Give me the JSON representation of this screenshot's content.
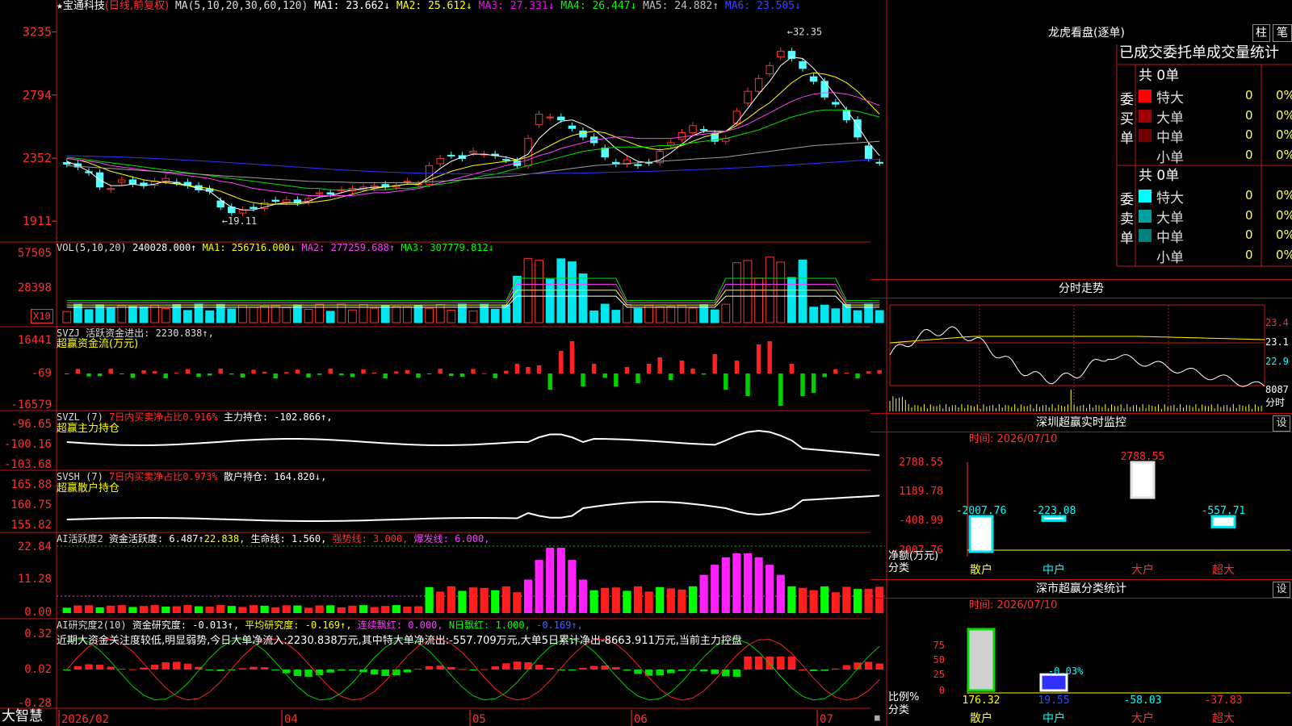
{
  "window": {
    "app_name": "大智慧",
    "date_axis": [
      "2026/02",
      "04",
      "05",
      "06",
      "07"
    ]
  },
  "header": {
    "stock": "宝通科技",
    "mode": "(日线,前复权)",
    "ma_label": "MA(5,10,20,30,60,120)",
    "ma_values": [
      {
        "label": "MA1:",
        "value": "23.662↓",
        "color": "#ffffff"
      },
      {
        "label": "MA2:",
        "value": "25.612↓",
        "color": "#ffff00"
      },
      {
        "label": "MA3:",
        "value": "27.331↓",
        "color": "#ff00ff"
      },
      {
        "label": "MA4:",
        "value": "26.447↓",
        "color": "#00ff00"
      },
      {
        "label": "MA5:",
        "value": "24.882↑",
        "color": "#c0c0c0"
      },
      {
        "label": "MA6:",
        "value": "23.505↓",
        "color": "#4040ff"
      }
    ]
  },
  "panels": {
    "price": {
      "y_ticks": [
        "3235",
        "2794",
        "2352",
        "1911"
      ],
      "high_label": "32.35",
      "low_label": "19.11"
    },
    "vol": {
      "title": "VOL(5,10,20)",
      "value": "240028.000↑",
      "ma1": "MA1: 256716.000↓",
      "ma2": "MA2: 277259.688↑",
      "ma3": "MA3: 307779.812↓",
      "y_ticks": [
        "57505",
        "28398"
      ],
      "unit": "X10"
    },
    "svzj": {
      "title": "SVZJ  活跃资金进出: 2230.838↑,",
      "subtitle": "超赢资金流(万元)",
      "y_ticks": [
        "16441",
        "-69",
        "-16579"
      ]
    },
    "svzl": {
      "title": "SVZL (7)",
      "ratio": "7日内买卖净占比0.916%",
      "hold": "主力持仓: -102.866↑,",
      "subtitle": "超赢主力持仓",
      "y_ticks": [
        "-96.65",
        "-100.16",
        "-103.68"
      ]
    },
    "svsh": {
      "title": "SVSH (7)",
      "ratio": "7日内买卖净占比0.973%",
      "hold": "散户持仓: 164.820↓,",
      "subtitle": "超赢散户持仓",
      "y_ticks": [
        "165.88",
        "160.75",
        "155.82"
      ]
    },
    "ai_active": {
      "title": "AI活跃度2",
      "activity": "资金活跃度: 6.487↑",
      "v2": "22.838,",
      "life": "生命线: 1.560,",
      "strong": "强势线: 3.000,",
      "burst": "爆发线: 6.000,",
      "y_ticks": [
        "22.84",
        "11.28",
        "0.00"
      ]
    },
    "ai_research": {
      "title": "AI研究度2(10)",
      "research": "资金研究度: -0.013↑,",
      "avg": "平均研究度: -0.169↑,",
      "cont": "连续飘红: 0.000,",
      "nday": "N日飘红: 1.000,",
      "last": "-0.169↑,",
      "y_ticks": [
        "0.32",
        "0.02",
        "-0.28"
      ],
      "comment": "近期大资金关注度较低,明显弱势,今日大单净流入:2230.838万元,其中特大单净流出:-557.709万元,大单5日累计净出-8663.911万元,当前主力控盘"
    }
  },
  "right": {
    "dragon_title": "龙虎看盘(逐单)",
    "btn1": "柱",
    "btn2": "笔",
    "tabs_label": "已成交委托单成交量统计",
    "buy_label": "委买单",
    "sell_label": "委卖单",
    "buy_total": "共 0单",
    "sell_total": "共 0单",
    "buy_rows": [
      {
        "name": "特大",
        "qty": "0",
        "pct": "0%",
        "color": "#ff0000"
      },
      {
        "name": "大单",
        "qty": "0",
        "pct": "0%",
        "color": "#a00000"
      },
      {
        "name": "中单",
        "qty": "0",
        "pct": "0%",
        "color": "#700000"
      },
      {
        "name": "小单",
        "qty": "0",
        "pct": "0%",
        "color": "#000000"
      }
    ],
    "sell_rows": [
      {
        "name": "特大",
        "qty": "0",
        "pct": "0%",
        "color": "#00ffff"
      },
      {
        "name": "大单",
        "qty": "0",
        "pct": "0%",
        "color": "#00a0a0"
      },
      {
        "name": "中单",
        "qty": "0",
        "pct": "0%",
        "color": "#008080"
      },
      {
        "name": "小单",
        "qty": "0",
        "pct": "0%",
        "color": "#000000"
      }
    ],
    "fenshi_title": "分时走势",
    "fenshi_y": [
      "23.4",
      "23.1",
      "22.9"
    ],
    "fenshi_vol": "8087",
    "fenshi_unit": "分时",
    "monitor_title": "深圳超赢实时监控",
    "monitor_time": "时间: 2026/07/10",
    "monitor_y": [
      "2788.55",
      "1189.78",
      "-408.99",
      "-2007.76"
    ],
    "monitor_axis_label": "净额(万元)",
    "monitor_axis_label2": "分类",
    "classify_title": "深市超赢分类统计",
    "classify_time": "时间: 2026/07/10",
    "classify_y": [
      "75",
      "50",
      "25",
      "0"
    ],
    "classify_axis_label": "比例%",
    "classify_axis_label2": "分类",
    "classify_extra_label": "-0.03%",
    "categories": [
      "散户",
      "中户",
      "大户",
      "超大"
    ]
  },
  "chart_data": [
    {
      "type": "candlestick",
      "title": "宝通科技 (日线,前复权)",
      "ylim": [
        18.5,
        33.8
      ],
      "x": [
        "2026/02",
        "04",
        "05",
        "06",
        "07"
      ],
      "closes": [
        23.1,
        22.9,
        22.5,
        21.5,
        21.4,
        22.0,
        21.7,
        21.6,
        21.9,
        22.1,
        21.8,
        21.6,
        21.3,
        21.2,
        20.1,
        19.7,
        19.9,
        20.0,
        20.4,
        20.5,
        20.6,
        20.4,
        20.7,
        21.1,
        21.0,
        21.3,
        21.4,
        21.5,
        21.6,
        21.5,
        21.6,
        21.9,
        21.7,
        23.0,
        23.5,
        23.7,
        23.5,
        24.0,
        23.8,
        23.7,
        23.4,
        23.0,
        24.9,
        26.6,
        26.4,
        26.2,
        25.6,
        25.0,
        24.6,
        23.6,
        23.1,
        23.4,
        23.0,
        23.2,
        24.0,
        24.6,
        25.3,
        25.8,
        25.5,
        24.7,
        24.9,
        26.8,
        28.2,
        29.1,
        30.0,
        31.0,
        30.5,
        29.8,
        28.9,
        27.8,
        27.3,
        26.2,
        25.0,
        23.5,
        23.2
      ],
      "series": [
        {
          "name": "MA1",
          "values": [
            23.3,
            23.0,
            22.6,
            22.0,
            21.6,
            21.6,
            21.7,
            21.6,
            21.7,
            21.9,
            21.8,
            21.6,
            21.4,
            21.2,
            20.6,
            20.1,
            19.9,
            19.9,
            20.1,
            20.3,
            20.4,
            20.4,
            20.5,
            20.8,
            20.9,
            21.1,
            21.3,
            21.4,
            21.5,
            21.5,
            21.6,
            21.7,
            21.7,
            22.2,
            22.8,
            23.3,
            23.6,
            23.8,
            23.8,
            23.7,
            23.6,
            23.4,
            23.8,
            24.9,
            25.6,
            26.1,
            26.2,
            25.9,
            25.5,
            24.9,
            24.2,
            23.7,
            23.3,
            23.2,
            23.4,
            23.9,
            24.5,
            25.1,
            25.4,
            25.4,
            25.4,
            26.0,
            27.0,
            28.0,
            28.9,
            30.0,
            30.6,
            30.5,
            29.8,
            28.9,
            27.9,
            26.9,
            25.8,
            24.6,
            23.7
          ]
        },
        {
          "name": "MA2",
          "values": [
            23.5,
            23.4,
            23.2,
            22.9,
            22.6,
            22.4,
            22.2,
            22.0,
            21.9,
            21.8,
            21.7,
            21.6,
            21.5,
            21.4,
            21.2,
            20.9,
            20.6,
            20.4,
            20.3,
            20.3,
            20.3,
            20.3,
            20.4,
            20.5,
            20.6,
            20.8,
            21.0,
            21.2,
            21.4,
            21.5,
            21.6,
            21.7,
            21.7,
            22.0,
            22.3,
            22.6,
            22.8,
            23.0,
            23.1,
            23.2,
            23.3,
            23.4,
            23.6,
            24.0,
            24.4,
            24.8,
            25.1,
            25.3,
            25.4,
            25.3,
            25.0,
            24.7,
            24.4,
            24.2,
            24.1,
            24.2,
            24.4,
            24.7,
            25.0,
            25.2,
            25.4,
            25.8,
            26.3,
            26.9,
            27.4,
            28.1,
            28.8,
            29.3,
            29.5,
            29.4,
            29.2,
            28.8,
            28.2,
            27.4,
            26.6
          ]
        },
        {
          "name": "MA3",
          "values": [
            23.5,
            23.4,
            23.3,
            23.2,
            23.0,
            22.9,
            22.8,
            22.7,
            22.6,
            22.5,
            22.4,
            22.3,
            22.2,
            22.1,
            21.9,
            21.8,
            21.6,
            21.4,
            21.3,
            21.2,
            21.1,
            21.0,
            20.9,
            20.9,
            20.9,
            20.9,
            20.9,
            21.0,
            21.1,
            21.1,
            21.2,
            21.3,
            21.4,
            21.6,
            21.8,
            22.0,
            22.2,
            22.4,
            22.6,
            22.8,
            23.0,
            23.2,
            23.4,
            23.7,
            23.9,
            24.2,
            24.4,
            24.6,
            24.8,
            24.9,
            25.0,
            25.0,
            24.9,
            24.9,
            24.9,
            24.9,
            25.0,
            25.1,
            25.2,
            25.3,
            25.4,
            25.6,
            25.9,
            26.3,
            26.7,
            27.1,
            27.5,
            27.8,
            28.0,
            28.1,
            28.1,
            28.0,
            27.8,
            27.5,
            27.2
          ]
        },
        {
          "name": "MA4",
          "values": [
            23.6,
            23.5,
            23.4,
            23.3,
            23.2,
            23.1,
            23.0,
            22.9,
            22.8,
            22.7,
            22.6,
            22.5,
            22.4,
            22.3,
            22.2,
            22.1,
            22.0,
            21.9,
            21.8,
            21.7,
            21.6,
            21.5,
            21.4,
            21.4,
            21.3,
            21.3,
            21.3,
            21.3,
            21.3,
            21.3,
            21.4,
            21.4,
            21.5,
            21.6,
            21.7,
            21.8,
            22.0,
            22.1,
            22.3,
            22.4,
            22.6,
            22.8,
            23.0,
            23.2,
            23.4,
            23.6,
            23.8,
            24.0,
            24.1,
            24.2,
            24.3,
            24.3,
            24.3,
            24.3,
            24.4,
            24.4,
            24.5,
            24.6,
            24.7,
            24.8,
            24.9,
            25.1,
            25.3,
            25.5,
            25.8,
            26.1,
            26.4,
            26.6,
            26.8,
            26.9,
            26.9,
            26.9,
            26.8,
            26.6,
            26.4
          ]
        },
        {
          "name": "MA5",
          "values": [
            23.0,
            22.95,
            22.9,
            22.85,
            22.8,
            22.75,
            22.7,
            22.65,
            22.6,
            22.55,
            22.5,
            22.45,
            22.4,
            22.35,
            22.3,
            22.25,
            22.2,
            22.15,
            22.1,
            22.05,
            22.0,
            21.95,
            21.9,
            21.88,
            21.86,
            21.84,
            21.82,
            21.8,
            21.8,
            21.8,
            21.8,
            21.8,
            21.82,
            21.86,
            21.9,
            21.95,
            22.0,
            22.06,
            22.12,
            22.18,
            22.24,
            22.3,
            22.4,
            22.5,
            22.6,
            22.7,
            22.8,
            22.9,
            23.0,
            23.05,
            23.1,
            23.15,
            23.2,
            23.25,
            23.3,
            23.35,
            23.4,
            23.45,
            23.5,
            23.55,
            23.6,
            23.7,
            23.8,
            23.9,
            24.0,
            24.1,
            24.2,
            24.3,
            24.4,
            24.45,
            24.5,
            24.55,
            24.6,
            24.65,
            24.7
          ]
        },
        {
          "name": "MA6",
          "values": [
            23.7,
            23.68,
            23.66,
            23.64,
            23.62,
            23.6,
            23.57,
            23.54,
            23.5,
            23.46,
            23.42,
            23.38,
            23.34,
            23.3,
            23.25,
            23.2,
            23.15,
            23.1,
            23.05,
            23.0,
            22.95,
            22.9,
            22.85,
            22.8,
            22.75,
            22.7,
            22.66,
            22.62,
            22.58,
            22.55,
            22.52,
            22.5,
            22.48,
            22.46,
            22.45,
            22.44,
            22.43,
            22.42,
            22.42,
            22.42,
            22.42,
            22.42,
            22.43,
            22.44,
            22.45,
            22.46,
            22.47,
            22.48,
            22.5,
            22.52,
            22.54,
            22.56,
            22.58,
            22.6,
            22.62,
            22.65,
            22.68,
            22.71,
            22.74,
            22.77,
            22.8,
            22.84,
            22.88,
            22.92,
            22.96,
            23.0,
            23.05,
            23.1,
            23.15,
            23.2,
            23.25,
            23.3,
            23.35,
            23.4,
            23.45
          ]
        }
      ]
    },
    {
      "type": "bar",
      "title": "深圳超赢实时监控",
      "categories": [
        "散户",
        "中户",
        "大户",
        "超大"
      ],
      "values": [
        -2007.76,
        -223.08,
        2788.55,
        -557.71
      ],
      "ylim": [
        -2007.76,
        2788.55
      ]
    },
    {
      "type": "bar",
      "title": "深市超赢分类统计",
      "categories": [
        "散户",
        "中户",
        "大户",
        "超大"
      ],
      "values": [
        176.32,
        19.55,
        -58.03,
        -37.83
      ],
      "ylim": [
        0,
        75
      ]
    }
  ]
}
